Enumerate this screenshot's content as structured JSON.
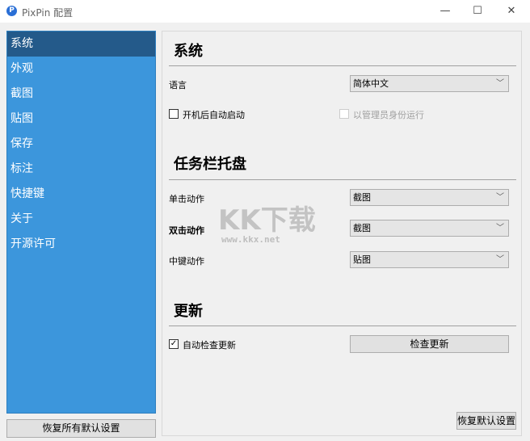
{
  "window": {
    "title": "PixPin 配置",
    "minimize": "—",
    "maximize": "☐",
    "close": "✕"
  },
  "sidebar": {
    "items": [
      {
        "label": "系统"
      },
      {
        "label": "外观"
      },
      {
        "label": "截图"
      },
      {
        "label": "贴图"
      },
      {
        "label": "保存"
      },
      {
        "label": "标注"
      },
      {
        "label": "快捷键"
      },
      {
        "label": "关于"
      },
      {
        "label": "开源许可"
      }
    ],
    "reset_all": "恢复所有默认设置"
  },
  "system": {
    "heading": "系统",
    "language_label": "语言",
    "language_value": "简体中文",
    "autostart_label": "开机后自动启动",
    "autostart_checked": false,
    "admin_label": "以管理员身份运行",
    "admin_checked": false
  },
  "tray": {
    "heading": "任务栏托盘",
    "single_label": "单击动作",
    "single_value": "截图",
    "double_label": "双击动作",
    "double_value": "截图",
    "middle_label": "中键动作",
    "middle_value": "贴图"
  },
  "update": {
    "heading": "更新",
    "auto_label": "自动检查更新",
    "auto_checked": true,
    "check_button": "检查更新"
  },
  "reset_default": "恢复默认设置",
  "watermark": {
    "text": "KK下载",
    "url": "www.kkx.net"
  }
}
